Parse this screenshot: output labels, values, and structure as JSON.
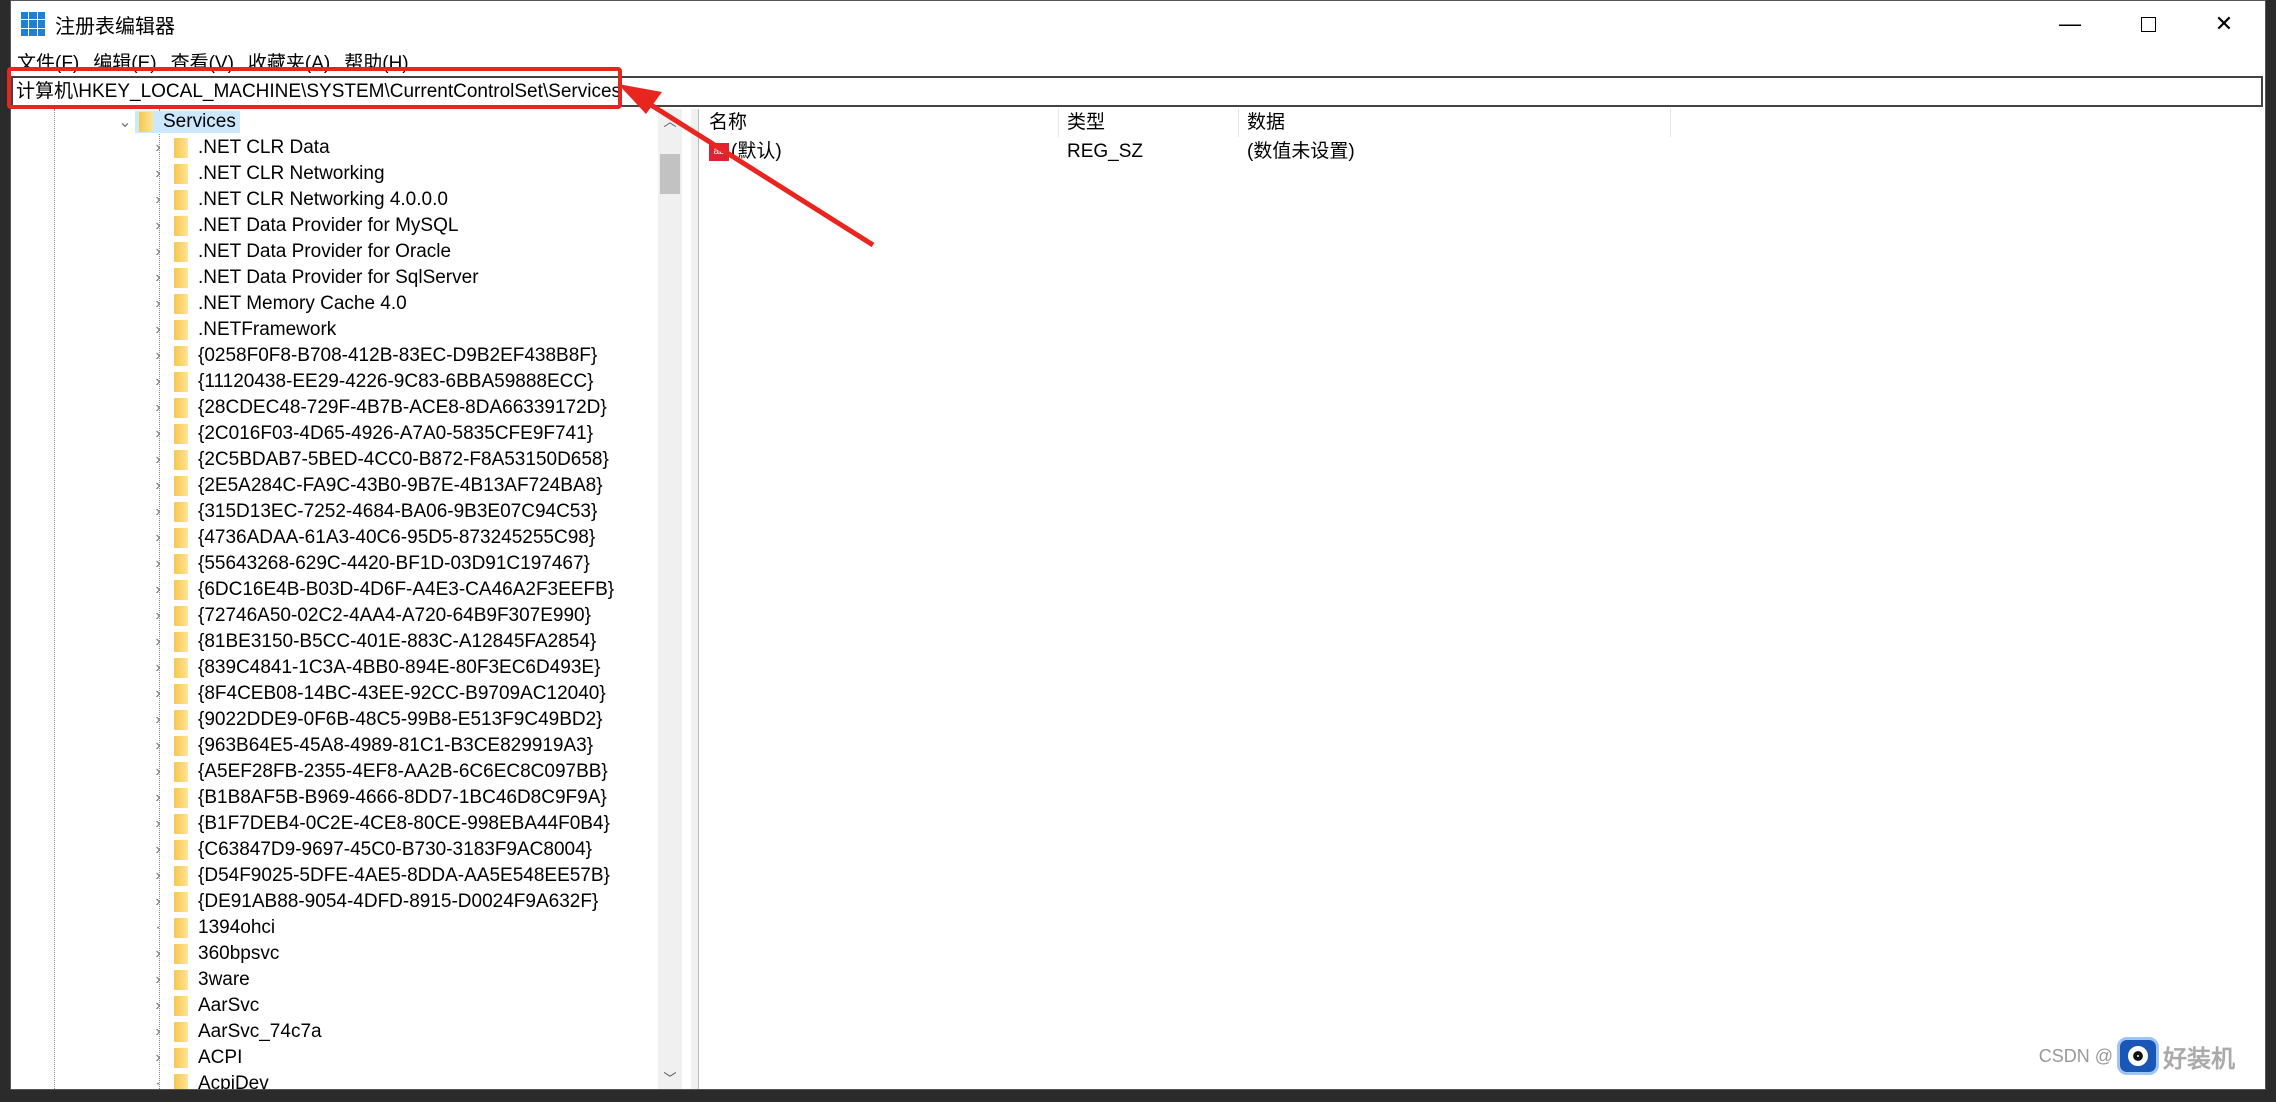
{
  "window": {
    "title": "注册表编辑器",
    "app_icon": "registry-editor-icon"
  },
  "menu": [
    "文件(F)",
    "编辑(E)",
    "查看(V)",
    "收藏夹(A)",
    "帮助(H)"
  ],
  "address": "计算机\\HKEY_LOCAL_MACHINE\\SYSTEM\\CurrentControlSet\\Services",
  "tree": {
    "selected": "Services",
    "children": [
      {
        "label": ".NET CLR Data",
        "expandable": true
      },
      {
        "label": ".NET CLR Networking",
        "expandable": true
      },
      {
        "label": ".NET CLR Networking 4.0.0.0",
        "expandable": true
      },
      {
        "label": ".NET Data Provider for MySQL",
        "expandable": true
      },
      {
        "label": ".NET Data Provider for Oracle",
        "expandable": true
      },
      {
        "label": ".NET Data Provider for SqlServer",
        "expandable": true
      },
      {
        "label": ".NET Memory Cache 4.0",
        "expandable": true
      },
      {
        "label": ".NETFramework",
        "expandable": true
      },
      {
        "label": "{0258F0F8-B708-412B-83EC-D9B2EF438B8F}",
        "expandable": true
      },
      {
        "label": "{11120438-EE29-4226-9C83-6BBA59888ECC}",
        "expandable": true
      },
      {
        "label": "{28CDEC48-729F-4B7B-ACE8-8DA66339172D}",
        "expandable": true
      },
      {
        "label": "{2C016F03-4D65-4926-A7A0-5835CFE9F741}",
        "expandable": true
      },
      {
        "label": "{2C5BDAB7-5BED-4CC0-B872-F8A53150D658}",
        "expandable": true
      },
      {
        "label": "{2E5A284C-FA9C-43B0-9B7E-4B13AF724BA8}",
        "expandable": true
      },
      {
        "label": "{315D13EC-7252-4684-BA06-9B3E07C94C53}",
        "expandable": true
      },
      {
        "label": "{4736ADAA-61A3-40C6-95D5-873245255C98}",
        "expandable": true
      },
      {
        "label": "{55643268-629C-4420-BF1D-03D91C197467}",
        "expandable": true
      },
      {
        "label": "{6DC16E4B-B03D-4D6F-A4E3-CA46A2F3EEFB}",
        "expandable": true
      },
      {
        "label": "{72746A50-02C2-4AA4-A720-64B9F307E990}",
        "expandable": true
      },
      {
        "label": "{81BE3150-B5CC-401E-883C-A12845FA2854}",
        "expandable": true
      },
      {
        "label": "{839C4841-1C3A-4BB0-894E-80F3EC6D493E}",
        "expandable": true
      },
      {
        "label": "{8F4CEB08-14BC-43EE-92CC-B9709AC12040}",
        "expandable": true
      },
      {
        "label": "{9022DDE9-0F6B-48C5-99B8-E513F9C49BD2}",
        "expandable": true
      },
      {
        "label": "{963B64E5-45A8-4989-81C1-B3CE829919A3}",
        "expandable": true
      },
      {
        "label": "{A5EF28FB-2355-4EF8-AA2B-6C6EC8C097BB}",
        "expandable": true
      },
      {
        "label": "{B1B8AF5B-B969-4666-8DD7-1BC46D8C9F9A}",
        "expandable": true
      },
      {
        "label": "{B1F7DEB4-0C2E-4CE8-80CE-998EBA44F0B4}",
        "expandable": true
      },
      {
        "label": "{C63847D9-9697-45C0-B730-3183F9AC8004}",
        "expandable": true
      },
      {
        "label": "{D54F9025-5DFE-4AE5-8DDA-AA5E548EE57B}",
        "expandable": true
      },
      {
        "label": "{DE91AB88-9054-4DFD-8915-D0024F9A632F}",
        "expandable": true
      },
      {
        "label": "1394ohci",
        "expandable": false
      },
      {
        "label": "360bpsvc",
        "expandable": true
      },
      {
        "label": "3ware",
        "expandable": true
      },
      {
        "label": "AarSvc",
        "expandable": true
      },
      {
        "label": "AarSvc_74c7a",
        "expandable": true
      },
      {
        "label": "ACPI",
        "expandable": true
      },
      {
        "label": "AcpiDev",
        "expandable": false
      }
    ]
  },
  "list": {
    "columns": [
      "名称",
      "类型",
      "数据"
    ],
    "rows": [
      {
        "name": "(默认)",
        "type": "REG_SZ",
        "data": "(数值未设置)"
      }
    ]
  },
  "watermark": {
    "text": "CSDN @",
    "brand": "好装机"
  },
  "colors": {
    "highlight": "#e8261f",
    "selection": "#cce8ff",
    "folder": "#f5c84c"
  }
}
